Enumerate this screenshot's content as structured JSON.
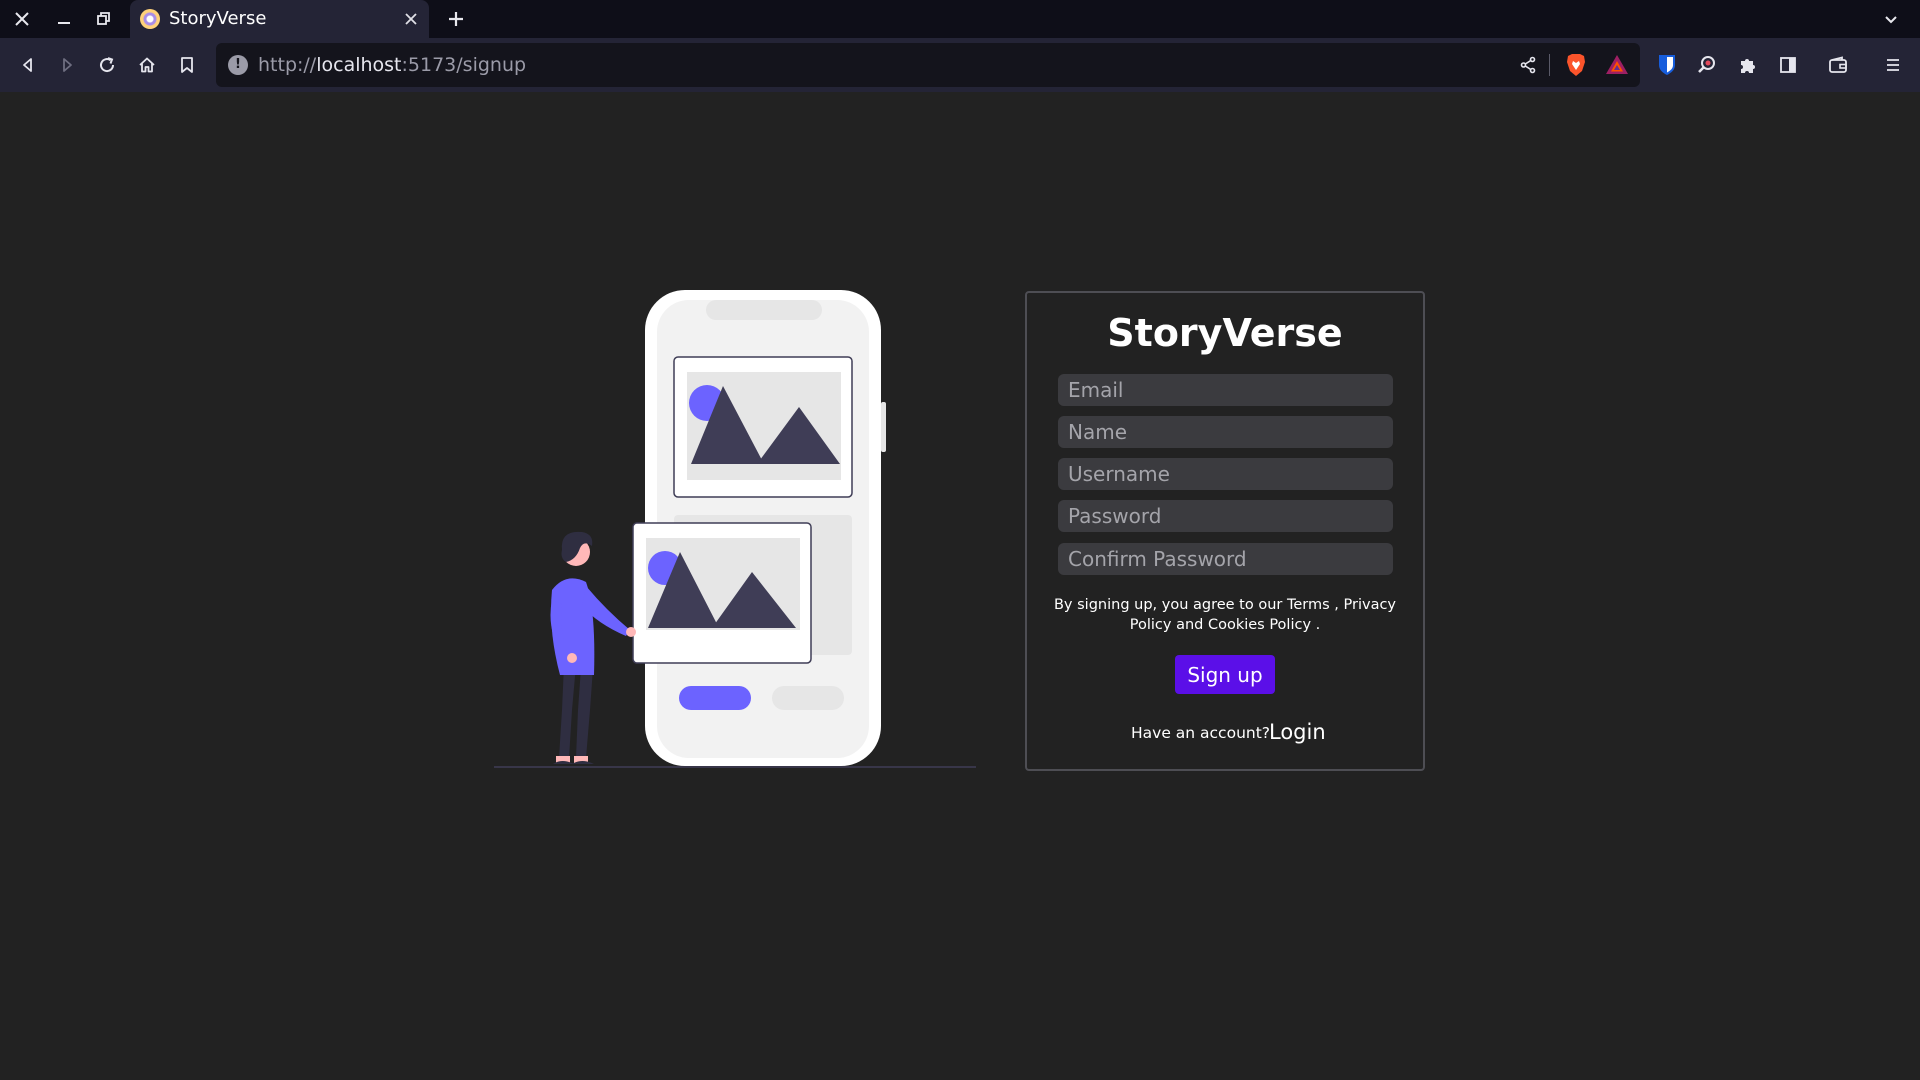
{
  "browser": {
    "tab": {
      "title": "StoryVerse"
    },
    "url": {
      "scheme": "http://",
      "host": "localhost",
      "path": ":5173/signup"
    },
    "icons": {
      "close_window": "close-icon",
      "minimize": "minimize-icon",
      "restore": "restore-icon",
      "new_tab": "plus-icon",
      "back": "back-icon",
      "forward": "forward-icon",
      "reload": "reload-icon",
      "home": "home-icon",
      "bookmark": "bookmark-icon",
      "share": "share-icon",
      "brave_shields": "brave-shield-icon",
      "brave_rewards": "bat-triangle-icon",
      "bitwarden": "bitwarden-icon",
      "zoom": "zoom-icon",
      "extensions": "puzzle-icon",
      "sidebar": "sidebar-icon",
      "wallet": "wallet-icon",
      "menu": "menu-icon"
    }
  },
  "signup": {
    "title": "StoryVerse",
    "fields": {
      "email": "Email",
      "name": "Name",
      "username": "Username",
      "password": "Password",
      "confirm_password": "Confirm Password"
    },
    "terms": {
      "prefix": "By signing up, you agree to our",
      "terms": "Terms",
      "sep": ",",
      "privacy": "Privacy Policy",
      "and": "and",
      "cookies": "Cookies Policy",
      "suffix": "."
    },
    "submit_label": "Sign up",
    "have_account": "Have an account?",
    "login_label": "Login"
  },
  "colors": {
    "page_bg": "#222222",
    "accent": "#6c63ff",
    "button": "#5b0fe8",
    "input_bg": "#3b3b3f",
    "card_border": "#4e4e54"
  }
}
